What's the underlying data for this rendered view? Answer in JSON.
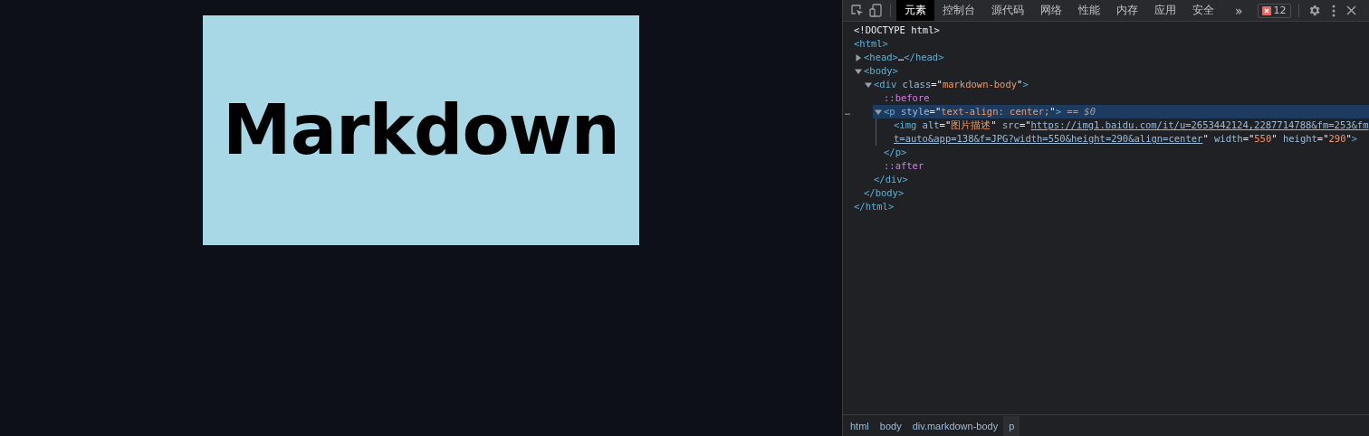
{
  "preview": {
    "image_text": "Markdown"
  },
  "devtools": {
    "tabs": [
      {
        "label": "元素",
        "selected": true
      },
      {
        "label": "控制台",
        "selected": false
      },
      {
        "label": "源代码",
        "selected": false
      },
      {
        "label": "网络",
        "selected": false
      },
      {
        "label": "性能",
        "selected": false
      },
      {
        "label": "内存",
        "selected": false
      },
      {
        "label": "应用",
        "selected": false
      },
      {
        "label": "安全",
        "selected": false
      }
    ],
    "more": "»",
    "issues": "12",
    "tree": [
      {
        "kind": "leaf",
        "selected": false,
        "tokens": [
          {
            "kind": "text",
            "text": "<!DOCTYPE html>"
          }
        ]
      },
      {
        "kind": "root",
        "selected": false,
        "tokens": [
          {
            "kind": "tag",
            "text": "<html>"
          }
        ],
        "close": [
          {
            "kind": "tag",
            "text": "</html>"
          }
        ],
        "children": [
          {
            "kind": "branch",
            "expanded": false,
            "selected": false,
            "tokens": [
              {
                "kind": "tag",
                "text": "<head>"
              },
              {
                "kind": "text",
                "text": "…"
              },
              {
                "kind": "tag",
                "text": "</head>"
              }
            ]
          },
          {
            "kind": "branch",
            "expanded": true,
            "selected": false,
            "tokens": [
              {
                "kind": "tag",
                "text": "<body>"
              }
            ],
            "close": [
              {
                "kind": "tag",
                "text": "</body>"
              }
            ],
            "children": [
              {
                "kind": "branch",
                "expanded": true,
                "selected": false,
                "tokens": [
                  {
                    "kind": "tag",
                    "text": "<div"
                  },
                  {
                    "kind": "attr",
                    "text": " class"
                  },
                  {
                    "kind": "text",
                    "text": "=\""
                  },
                  {
                    "kind": "value",
                    "text": "markdown-body"
                  },
                  {
                    "kind": "text",
                    "text": "\""
                  },
                  {
                    "kind": "tag",
                    "text": ">"
                  }
                ],
                "close": [
                  {
                    "kind": "tag",
                    "text": "</div>"
                  }
                ],
                "children": [
                  {
                    "kind": "leaf",
                    "selected": false,
                    "tokens": [
                      {
                        "kind": "pseudo",
                        "text": "::before"
                      }
                    ]
                  },
                  {
                    "kind": "branch",
                    "expanded": true,
                    "selected": true,
                    "actions": "…",
                    "tokens": [
                      {
                        "kind": "tag",
                        "text": "<p"
                      },
                      {
                        "kind": "attr",
                        "text": " style"
                      },
                      {
                        "kind": "text",
                        "text": "=\""
                      },
                      {
                        "kind": "value",
                        "text": "text-align: center;"
                      },
                      {
                        "kind": "text",
                        "text": "\""
                      },
                      {
                        "kind": "tag",
                        "text": ">"
                      },
                      {
                        "kind": "ref",
                        "text": " == "
                      },
                      {
                        "kind": "var",
                        "text": "$0"
                      }
                    ],
                    "close": [
                      {
                        "kind": "tag",
                        "text": "</p>"
                      }
                    ],
                    "children": [
                      {
                        "kind": "leaf",
                        "selected": false,
                        "tokens": [
                          {
                            "kind": "tag",
                            "text": "<img"
                          },
                          {
                            "kind": "attr",
                            "text": " alt"
                          },
                          {
                            "kind": "text",
                            "text": "=\""
                          },
                          {
                            "kind": "value",
                            "text": "图片描述"
                          },
                          {
                            "kind": "text",
                            "text": "\""
                          },
                          {
                            "kind": "attr",
                            "text": " src"
                          },
                          {
                            "kind": "text",
                            "text": "=\""
                          },
                          {
                            "kind": "link",
                            "text": "https://img1.baidu.com/it/u=2653442124,2287714788&fm=253&fmt=auto&app=138&f=JPG?width=550&height=290&align=center"
                          },
                          {
                            "kind": "text",
                            "text": "\""
                          },
                          {
                            "kind": "attr",
                            "text": " width"
                          },
                          {
                            "kind": "text",
                            "text": "=\""
                          },
                          {
                            "kind": "value",
                            "text": "550"
                          },
                          {
                            "kind": "text",
                            "text": "\""
                          },
                          {
                            "kind": "attr",
                            "text": " height"
                          },
                          {
                            "kind": "text",
                            "text": "=\""
                          },
                          {
                            "kind": "value",
                            "text": "290"
                          },
                          {
                            "kind": "text",
                            "text": "\""
                          },
                          {
                            "kind": "tag",
                            "text": ">"
                          }
                        ]
                      }
                    ]
                  },
                  {
                    "kind": "leaf",
                    "selected": false,
                    "tokens": [
                      {
                        "kind": "pseudo",
                        "text": "::after"
                      }
                    ]
                  }
                ]
              }
            ]
          }
        ]
      }
    ],
    "breadcrumbs": [
      {
        "label": "html",
        "selected": false
      },
      {
        "label": "body",
        "selected": false
      },
      {
        "label": "div.markdown-body",
        "selected": false
      },
      {
        "label": "p",
        "selected": true
      }
    ]
  }
}
